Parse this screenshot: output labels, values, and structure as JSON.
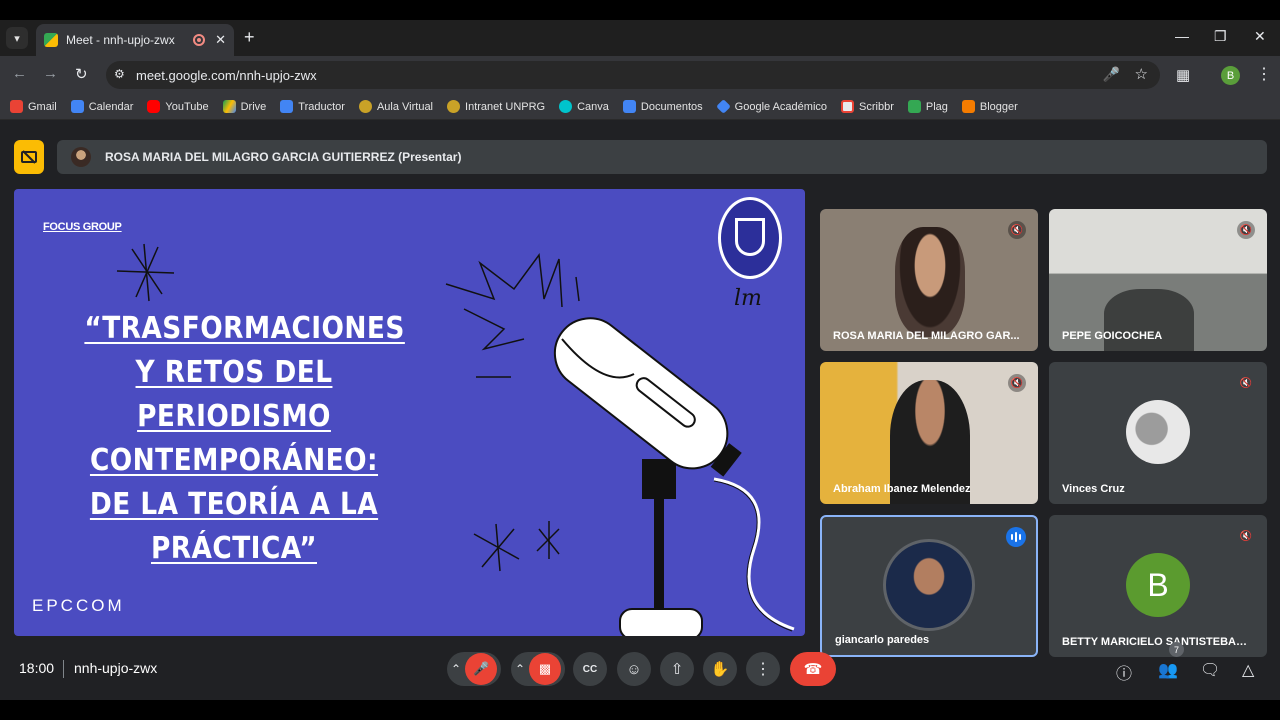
{
  "browser": {
    "tab_title": "Meet - nnh-upjo-zwx",
    "url": "meet.google.com/nnh-upjo-zwx",
    "profile_initial": "B",
    "bookmarks": [
      "Gmail",
      "Calendar",
      "YouTube",
      "Drive",
      "Traductor",
      "Aula Virtual",
      "Intranet UNPRG",
      "Canva",
      "Documentos",
      "Google Académico",
      "Scribbr",
      "Plag",
      "Blogger"
    ]
  },
  "meet": {
    "presenter_label": "ROSA MARIA DEL MILAGRO GARCIA GUITIERREZ (Presentar)",
    "slide": {
      "tag": "FOCUS GROUP",
      "title": "“TRASFORMACIONES Y RETOS DEL PERIODISMO CONTEMPORÁNEO: DE LA TEORÍA A LA PRÁCTICA”",
      "brand": "EPCCOM",
      "signature": "lm"
    },
    "participants": [
      {
        "name": "ROSA MARIA DEL MILAGRO GAR...",
        "muted": true
      },
      {
        "name": "PEPE GOICOCHEA",
        "muted": true
      },
      {
        "name": "Abraham Ibanez Melendez",
        "muted": true
      },
      {
        "name": "Vinces Cruz",
        "muted": true
      },
      {
        "name": "giancarlo paredes",
        "muted": false,
        "speaking": true
      },
      {
        "name": "BETTY MARICIELO SANTISTEBAN ...",
        "muted": true,
        "initial": "B"
      }
    ],
    "footer": {
      "time": "18:00",
      "meeting_code": "nnh-upjo-zwx",
      "participant_count": "7"
    }
  },
  "colors": {
    "slide_bg": "#4b4cc1",
    "meet_bg": "#202124",
    "end_call": "#ea4335",
    "present_pill": "#fbbc04"
  }
}
